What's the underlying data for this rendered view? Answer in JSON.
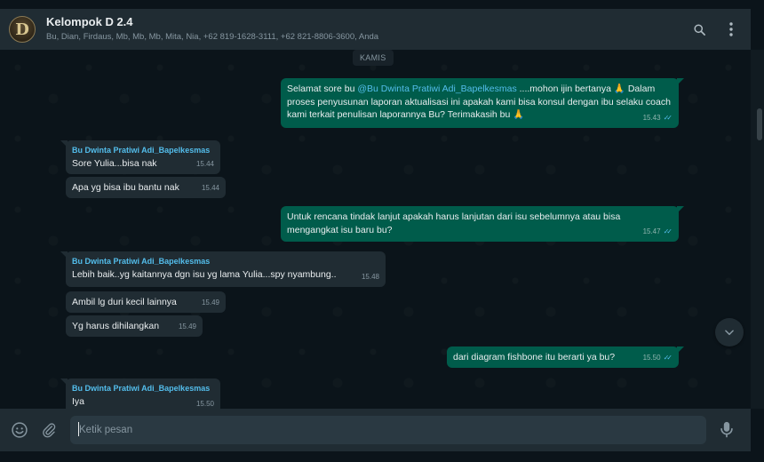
{
  "header": {
    "avatar_letter": "D",
    "title": "Kelompok D 2.4",
    "members": "Bu, Dian, Firdaus, Mb, Mb, Mb, Mita, Nia, +62 819-1628-3111, +62 821-8806-3600, Anda",
    "icons": [
      "search-icon",
      "menu-icon"
    ]
  },
  "chat": {
    "date_chip": "KAMIS",
    "messages": [
      {
        "dir": "out",
        "text_before": "Selamat sore bu ",
        "mention": "@Bu Dwinta Pratiwi Adi_Bapelkesmas",
        "text_after": " ....mohon ijin bertanya 🙏 Dalam proses penyusunan laporan aktualisasi ini apakah kami bisa konsul dengan ibu selaku coach kami terkait penulisan laporannya Bu? Terimakasih bu 🙏",
        "time": "15.43"
      },
      {
        "dir": "in",
        "sender": "Bu Dwinta Pratiwi Adi_Bapelkesmas",
        "text": "Sore Yulia...bisa nak",
        "time": "15.44"
      },
      {
        "dir": "in",
        "text": "Apa yg bisa ibu bantu nak",
        "time": "15.44"
      },
      {
        "dir": "out",
        "text": "Untuk rencana tindak lanjut apakah harus lanjutan dari isu sebelumnya atau bisa mengangkat isu baru bu?",
        "time": "15.47"
      },
      {
        "dir": "in",
        "sender": "Bu Dwinta Pratiwi Adi_Bapelkesmas",
        "text": "Lebih baik..yg kaitannya dgn isu yg lama Yulia...spy nyambung..",
        "time": "15.48"
      },
      {
        "dir": "in",
        "text": "Ambil lg duri kecil lainnya",
        "time": "15.49"
      },
      {
        "dir": "in",
        "text": "Yg harus dihilangkan",
        "time": "15.49"
      },
      {
        "dir": "out",
        "text": "dari diagram fishbone itu berarti ya bu?",
        "time": "15.50"
      },
      {
        "dir": "in",
        "sender": "Bu Dwinta Pratiwi Adi_Bapelkesmas",
        "text": "Iya",
        "time": "15.50"
      }
    ]
  },
  "composer": {
    "placeholder": "Ketik pesan",
    "icons": [
      "emoji-icon",
      "attach-icon",
      "microphone-icon"
    ]
  },
  "colors": {
    "background": "#0b141a",
    "panel": "#202c33",
    "outgoing_bubble": "#005c4b",
    "incoming_bubble": "#202c33",
    "sender_name": "#53bdeb",
    "read_ticks": "#53bdeb"
  }
}
